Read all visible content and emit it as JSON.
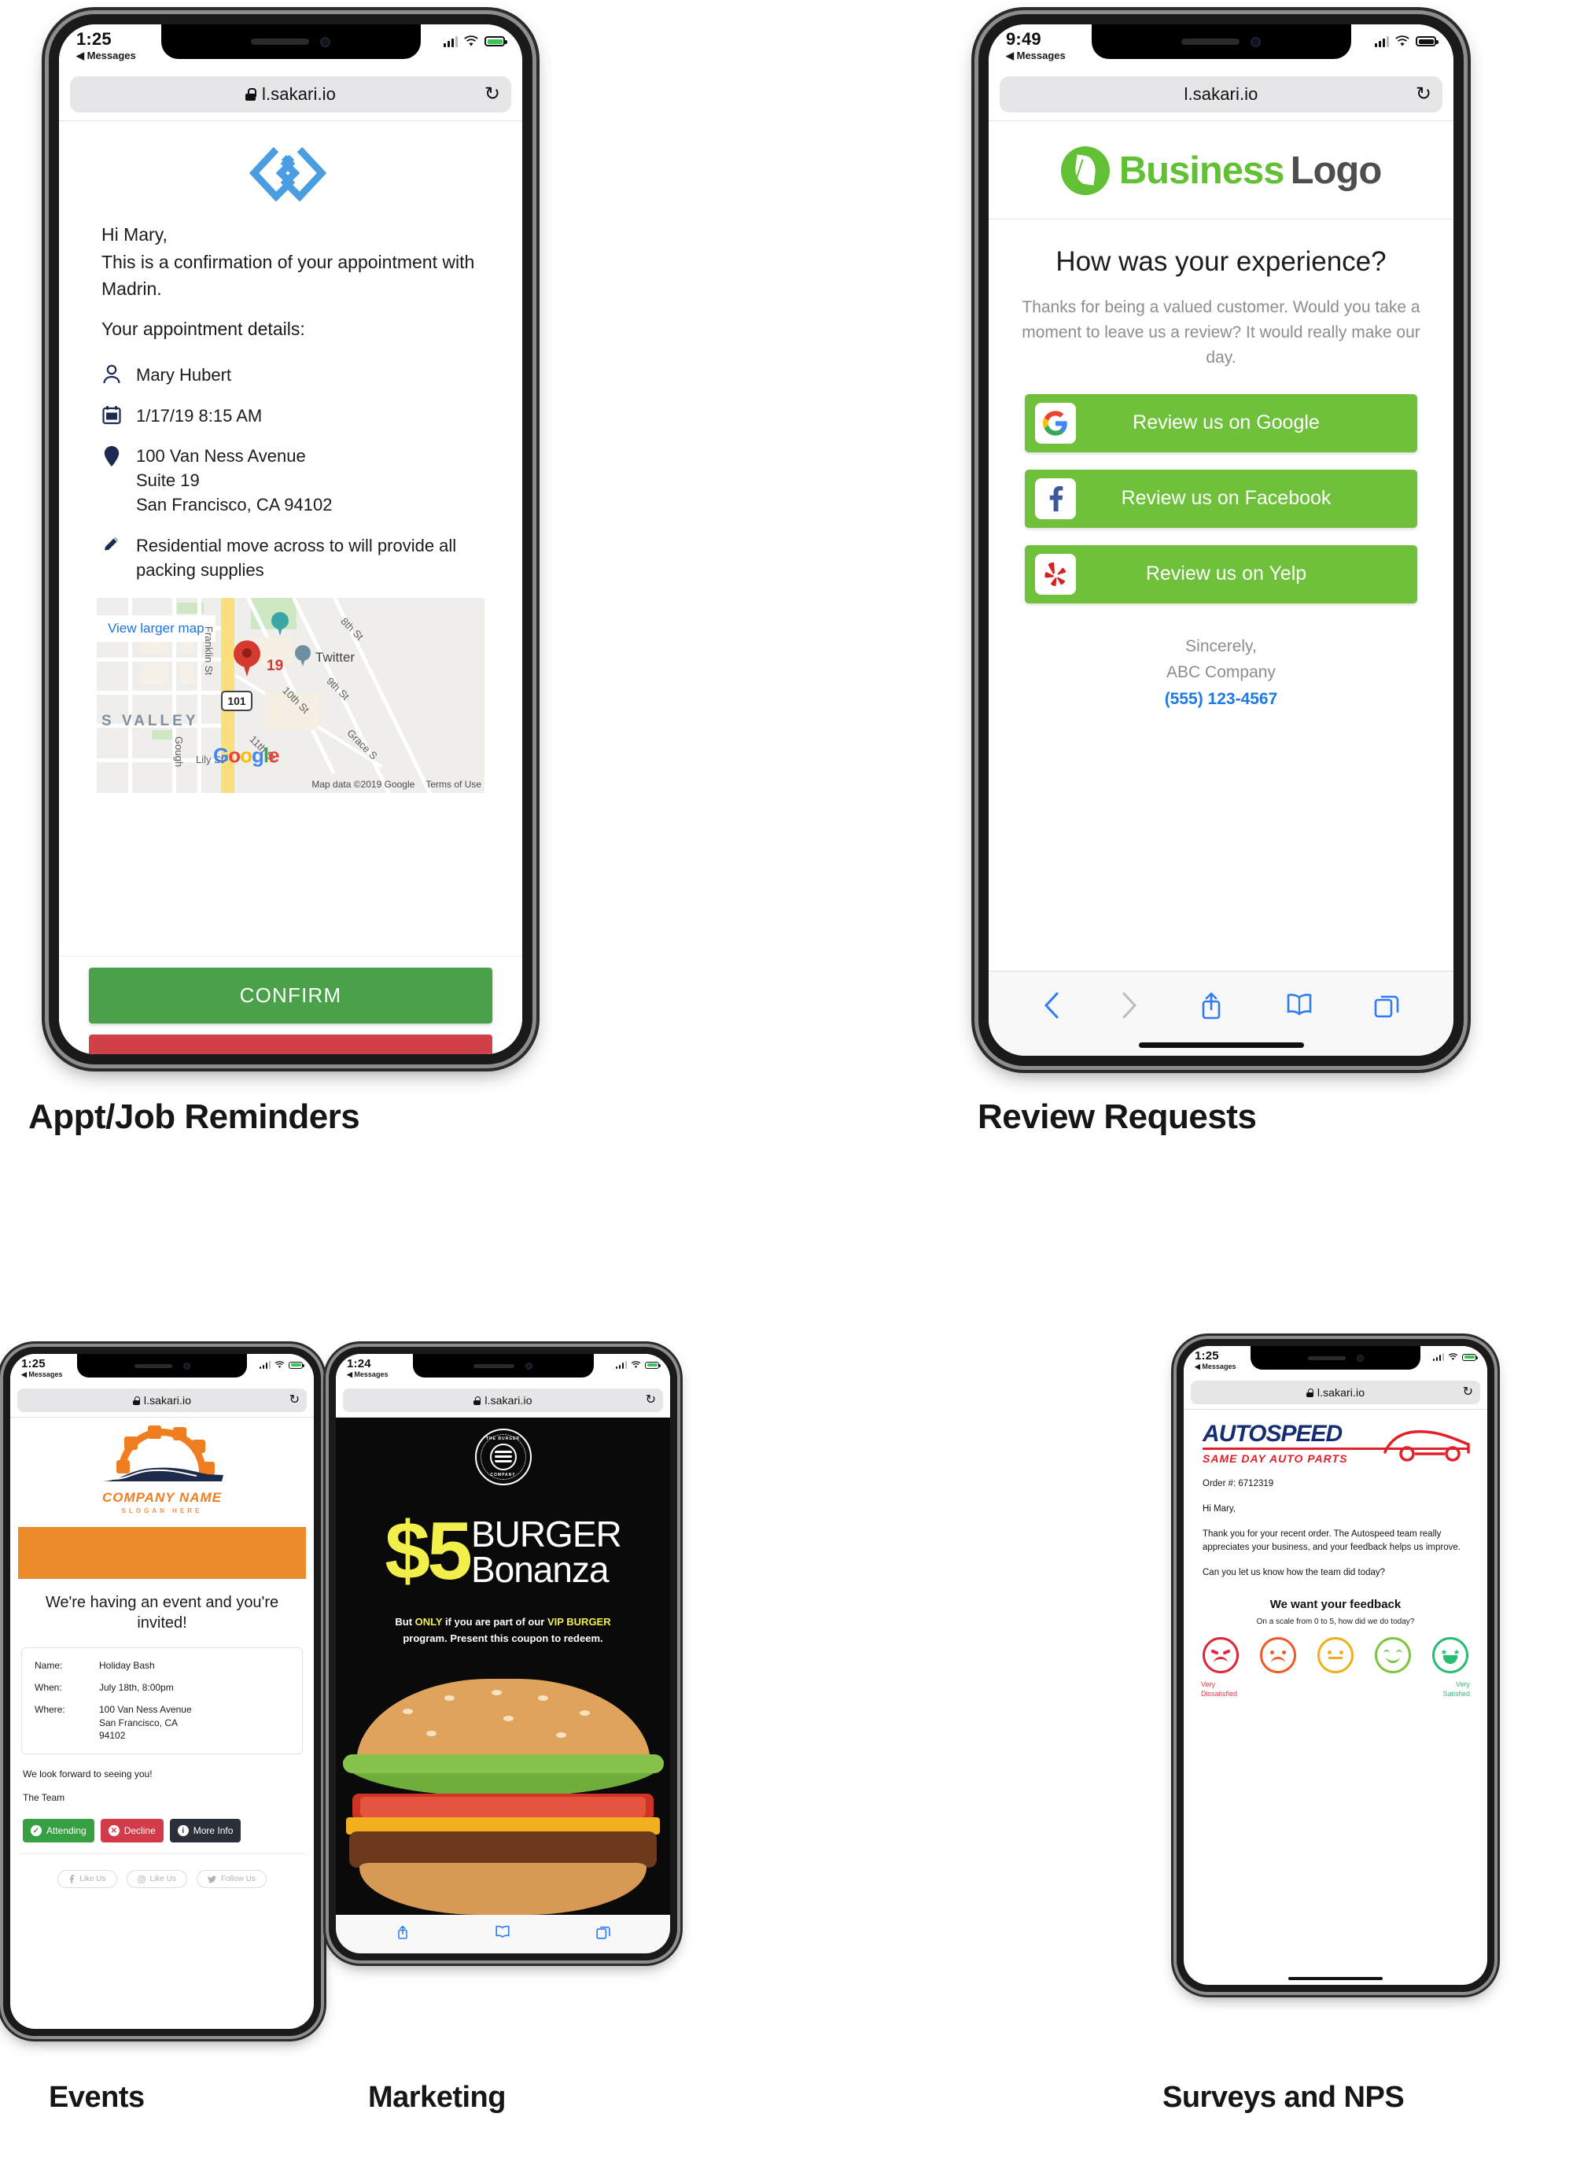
{
  "phones": [
    {
      "id": "appointment",
      "caption": "Appt/Job Reminders",
      "status": {
        "time": "1:25",
        "back": "Messages"
      },
      "url": "l.sakari.io",
      "greeting": "Hi Mary,",
      "intro": "This is a confirmation of your appointment with Madrin.",
      "details_label": "Your appointment details:",
      "details": [
        {
          "icon": "person-icon",
          "text": "Mary Hubert"
        },
        {
          "icon": "calendar-icon",
          "text": "1/17/19   8:15 AM"
        },
        {
          "icon": "location-pin-icon",
          "text": "100 Van Ness Avenue\nSuite 19\nSan Francisco, CA 94102"
        },
        {
          "icon": "pencil-icon",
          "text": "Residential move across to will provide all packing supplies"
        }
      ],
      "map": {
        "view_larger": "View larger map",
        "marker_number": "19",
        "labels": [
          "Franklin St",
          "8th St",
          "9th St",
          "10th St",
          "11th St",
          "Twitter",
          "S VALLEY",
          "Lily St",
          "Gough",
          "Grace S",
          "101"
        ],
        "attribution": "Map data ©2019 Google",
        "terms": "Terms of Use",
        "brand": "Google"
      },
      "confirm_label": "CONFIRM"
    },
    {
      "id": "review",
      "caption": "Review Requests",
      "status": {
        "time": "9:49",
        "back": "Messages"
      },
      "url": "l.sakari.io",
      "logo": {
        "part1": "Business",
        "part2": "Logo"
      },
      "heading": "How was your experience?",
      "subtext": "Thanks for being a valued customer. Would you take a moment to leave us a review? It would really make our day.",
      "buttons": [
        {
          "icon": "google-icon",
          "label": "Review us on Google"
        },
        {
          "icon": "facebook-icon",
          "label": "Review us on Facebook"
        },
        {
          "icon": "yelp-icon",
          "label": "Review us on Yelp"
        }
      ],
      "signoff": "Sincerely,",
      "company": "ABC Company",
      "phone_number": "(555) 123-4567"
    },
    {
      "id": "events",
      "caption": "Events",
      "status": {
        "time": "1:25",
        "back": "Messages"
      },
      "url": "l.sakari.io",
      "logo": {
        "name": "COMPANY NAME",
        "slogan": "SLOGAN HERE"
      },
      "heading": "We're having an event and you're invited!",
      "fields": [
        {
          "key": "Name:",
          "value": "Holiday Bash"
        },
        {
          "key": "When:",
          "value": "July 18th, 8:00pm"
        },
        {
          "key": "Where:",
          "value": "100 Van Ness Avenue\nSan Francisco, CA\n94102"
        }
      ],
      "closing": "We look forward to seeing you!",
      "signature": "The Team",
      "rsvp": [
        {
          "label": "Attending",
          "icon": "check-circle-icon"
        },
        {
          "label": "Decline",
          "icon": "x-circle-icon"
        },
        {
          "label": "More Info",
          "icon": "info-circle-icon"
        }
      ],
      "socials": [
        {
          "icon": "facebook-icon",
          "label": "Like Us"
        },
        {
          "icon": "instagram-icon",
          "label": "Like Us"
        },
        {
          "icon": "twitter-icon",
          "label": "Follow Us"
        }
      ]
    },
    {
      "id": "marketing",
      "caption": "Marketing",
      "status": {
        "time": "1:24",
        "back": "Messages"
      },
      "url": "l.sakari.io",
      "stamp": {
        "top": "THE BURGER",
        "bottom": "COMPANY"
      },
      "price": "$5",
      "title_line1": "BURGER",
      "title_line2": "Bonanza",
      "fineprint": "But ONLY if you are part of our VIP BURGER program. Present this coupon to redeem.",
      "highlight1": "ONLY",
      "highlight2": "VIP BURGER"
    },
    {
      "id": "surveys",
      "caption": "Surveys and NPS",
      "status": {
        "time": "1:25",
        "back": "Messages"
      },
      "url": "l.sakari.io",
      "logo": {
        "name": "AUTOSPEED",
        "tagline": "SAME DAY AUTO PARTS"
      },
      "order": "Order #: 6712319",
      "greeting": "Hi Mary,",
      "body1": "Thank you for your recent order. The Autospeed team really appreciates your business, and your feedback helps us improve.",
      "body2": "Can you let us know how the team did today?",
      "feedback_heading": "We want your feedback",
      "feedback_sub": "On a scale from 0 to 5, how did we do today?",
      "legend_left": "Very\nDissatisfied",
      "legend_right": "Very\nSatisfied",
      "faces": [
        "angry",
        "sad",
        "neutral",
        "happy",
        "excited"
      ]
    }
  ],
  "colors": {
    "confirm_green": "#4aa14a",
    "decline_red": "#cf4048",
    "review_green": "#6fc03a",
    "brand_green": "#62c034",
    "orange": "#eb8b2a",
    "marketing_yellow": "#f2ef4a",
    "autospeed_blue": "#152d73",
    "autospeed_red": "#e12029",
    "link_blue": "#1e7ae0"
  }
}
